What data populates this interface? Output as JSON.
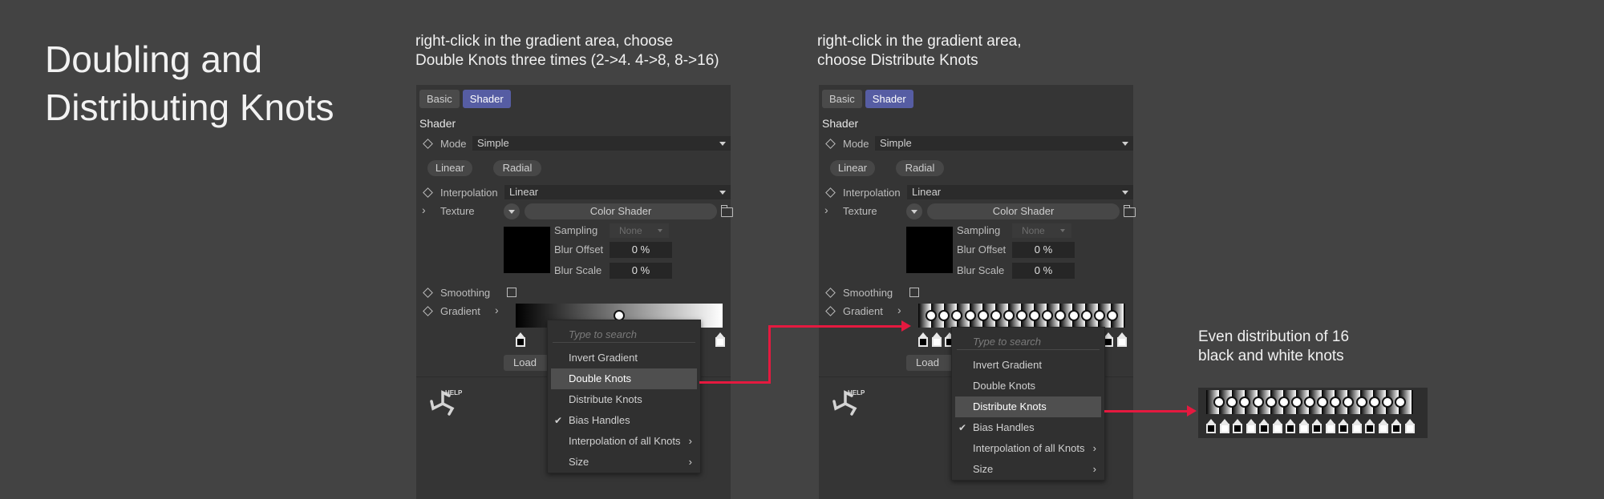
{
  "title": {
    "line1": "Doubling and",
    "line2": "Distributing Knots"
  },
  "captions": {
    "left": {
      "line1": "right-click in the gradient area, choose",
      "line2": "Double Knots three times (2->4. 4->8, 8->16)"
    },
    "middle": {
      "line1": "right-click in the gradient area,",
      "line2": "choose Distribute Knots"
    },
    "right": {
      "line1": "Even distribution of 16",
      "line2": "black and white knots"
    }
  },
  "panel": {
    "tabs": [
      "Basic",
      "Shader"
    ],
    "active_tab": "Shader",
    "section_label": "Shader",
    "mode_label": "Mode",
    "mode_value": "Simple",
    "linear_button": "Linear",
    "radial_button": "Radial",
    "interpolation_label": "Interpolation",
    "interpolation_value": "Linear",
    "texture_label": "Texture",
    "color_shader_button": "Color Shader",
    "sampling_label": "Sampling",
    "sampling_value": "None",
    "blur_offset_label": "Blur Offset",
    "blur_offset_value": "0 %",
    "blur_scale_label": "Blur Scale",
    "blur_scale_value": "0 %",
    "smoothing_label": "Smoothing",
    "gradient_label": "Gradient",
    "load_button": "Load Preset",
    "help_text": "HELP"
  },
  "context_menu": {
    "search_placeholder": "Type to search",
    "items": [
      "Invert Gradient",
      "Double Knots",
      "Distribute Knots",
      "Bias Handles",
      "Interpolation of all Knots",
      "Size"
    ],
    "left_selected": "Double Knots",
    "right_selected": "Distribute Knots",
    "checked_item": "Bias Handles"
  },
  "colors": {
    "background": "#434343",
    "panel": "#353535",
    "active_tab": "#565da3",
    "arrow": "#e5193f"
  },
  "knot_counts": {
    "before": 2,
    "after": 16
  }
}
